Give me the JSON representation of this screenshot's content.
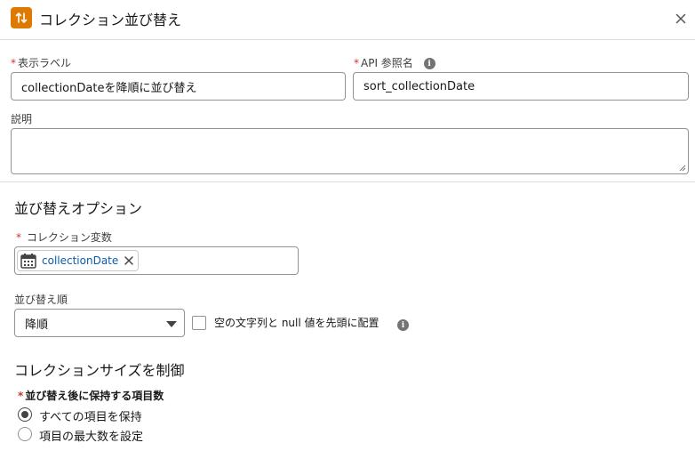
{
  "header": {
    "title": "コレクション並び替え",
    "icon": "sort-arrows-icon",
    "icon_color": "#dd7a01"
  },
  "fields": {
    "display_label": {
      "label": "表示ラベル",
      "required": "*",
      "value": "collectionDateを降順に並び替え"
    },
    "api_name": {
      "label": "API 参照名",
      "required": "*",
      "value": "sort_collectionDate"
    },
    "description": {
      "label": "説明",
      "value": ""
    }
  },
  "sort_options": {
    "title": "並び替えオプション",
    "collection_variable": {
      "label": "コレクション変数",
      "required": "*",
      "pill": "collectionDate"
    },
    "sort_order": {
      "label": "並び替え順",
      "selected": "降順"
    },
    "nulls_first": {
      "label": "空の文字列と null 値を先頭に配置",
      "checked": false
    }
  },
  "collection_size": {
    "title": "コレクションサイズを制御",
    "items_label": "並び替え後に保持する項目数",
    "required": "*",
    "options": [
      {
        "label": "すべての項目を保持",
        "checked": true
      },
      {
        "label": "項目の最大数を設定",
        "checked": false
      }
    ]
  }
}
